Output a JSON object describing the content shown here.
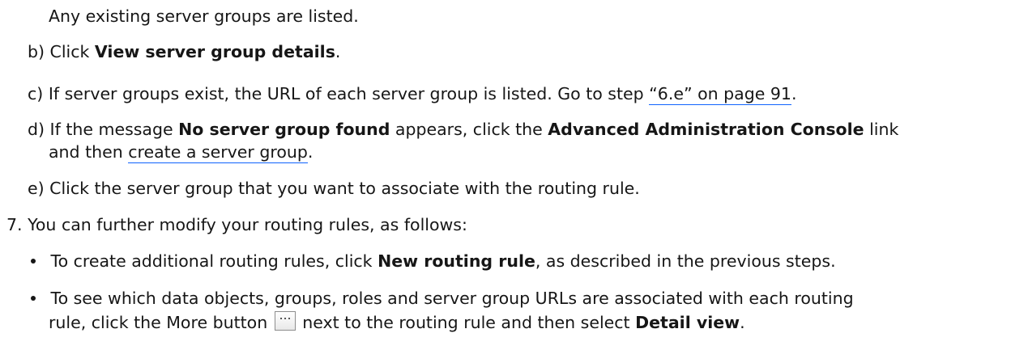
{
  "intro_note": "Any existing server groups are listed.",
  "substeps": {
    "b": {
      "label": "b)",
      "pre": "Click ",
      "bold": "View server group details",
      "post": "."
    },
    "c": {
      "label": "c)",
      "pre": "If server groups exist, the URL of each server group is listed. Go to step ",
      "link": "“6.e” on page 91",
      "post": "."
    },
    "d": {
      "label": "d)",
      "pre": "If the message ",
      "bold1": "No server group found",
      "mid": " appears, click the ",
      "bold2": "Advanced Administration Console",
      "post": " link",
      "line2_pre": "and then ",
      "link": "create a server group",
      "line2_post": "."
    },
    "e": {
      "label": "e)",
      "text": "Click the server group that you want to associate with the routing rule."
    }
  },
  "step7": {
    "label": "7.",
    "text": "You can further modify your routing rules, as follows:"
  },
  "bullets": {
    "first": {
      "pre": "To create additional routing rules, click ",
      "bold": "New routing rule",
      "post": ", as described in the previous steps."
    },
    "second": {
      "line1": "To see which data objects, groups, roles and server group URLs are associated with each routing",
      "line2_pre": "rule, click the More button ",
      "line2_mid": " next to the routing rule and then select ",
      "bold": "Detail view",
      "post": "."
    }
  },
  "icons": {
    "more_button": "more-ellipsis-icon"
  }
}
